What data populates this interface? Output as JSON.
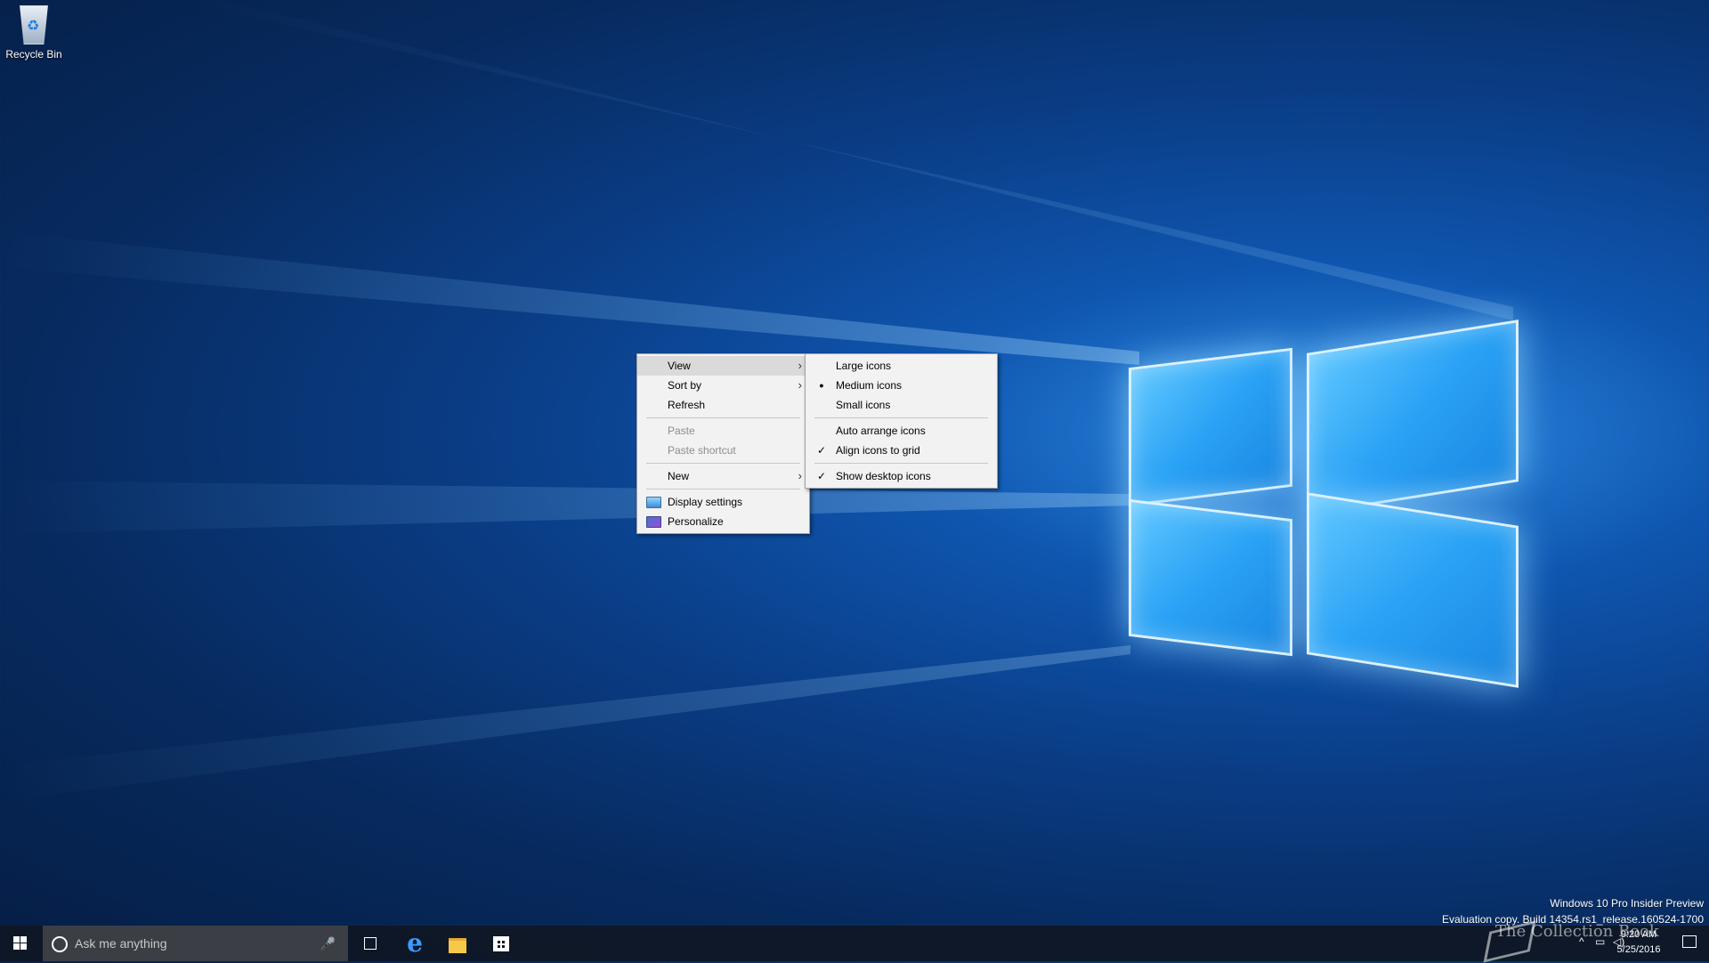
{
  "desktop": {
    "recycle_bin_label": "Recycle Bin"
  },
  "context_menu": {
    "items": [
      {
        "label": "View",
        "submenu": true,
        "highlighted": true
      },
      {
        "label": "Sort by",
        "submenu": true
      },
      {
        "label": "Refresh"
      },
      {
        "label": "Paste",
        "disabled": true
      },
      {
        "label": "Paste shortcut",
        "disabled": true
      },
      {
        "label": "New",
        "submenu": true
      },
      {
        "label": "Display settings",
        "icon": "display-icon"
      },
      {
        "label": "Personalize",
        "icon": "personalize-icon"
      }
    ]
  },
  "view_submenu": {
    "items": [
      {
        "label": "Large icons"
      },
      {
        "label": "Medium icons",
        "mark": "bullet"
      },
      {
        "label": "Small icons"
      },
      {
        "label": "Auto arrange icons"
      },
      {
        "label": "Align icons to grid",
        "mark": "check"
      },
      {
        "label": "Show desktop icons",
        "mark": "check"
      }
    ]
  },
  "glyphs": {
    "arrow": "›",
    "bullet": "●",
    "check": "✓",
    "mic": "🎤",
    "edge": "e"
  },
  "taskbar": {
    "search_placeholder": "Ask me anything",
    "pinned": [
      "task-view-icon",
      "edge-icon",
      "file-explorer-icon",
      "store-icon"
    ],
    "clock_time": "9:20 AM",
    "clock_date": "5/25/2016"
  },
  "watermark": {
    "line1": "Windows 10 Pro Insider Preview",
    "line2": "Evaluation copy. Build 14354.rs1_release.160524-1700"
  },
  "site_watermark": "The Collection Book",
  "colors": {
    "menu_bg": "#f2f2f2",
    "menu_highlight": "#dadada",
    "disabled_text": "#8d8d8d",
    "taskbar": "#0f1724"
  }
}
